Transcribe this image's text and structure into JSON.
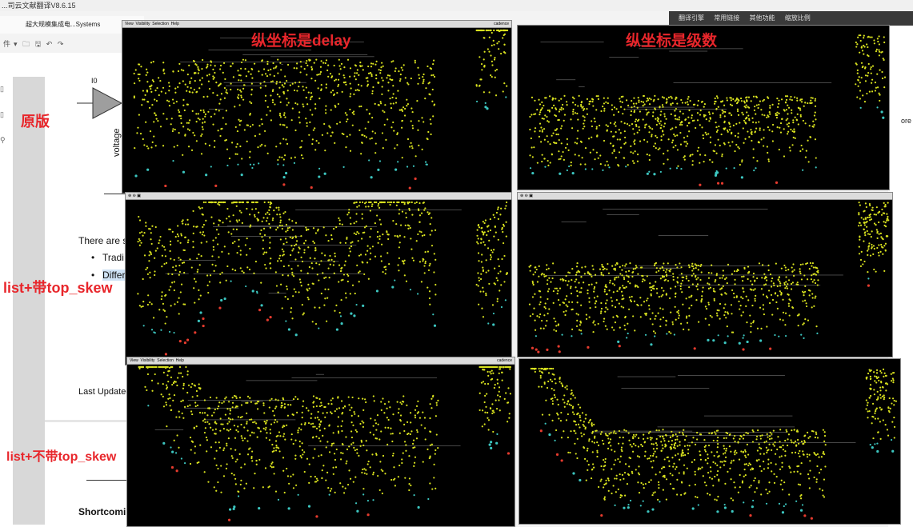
{
  "window": {
    "title": "...司云文献翻译V8.6.15"
  },
  "tab": {
    "label": "超大规模集成电...Systems"
  },
  "toolbar": {
    "file_menu": "件",
    "items": [
      "folder-icon",
      "save-icon",
      "undo-icon",
      "redo-icon"
    ]
  },
  "document": {
    "label_i0": "I0",
    "ylabel": "voltage",
    "para": "There are s",
    "bullet1": "Tradi",
    "bullet2": "Differ",
    "last_updated": "Last Updated",
    "shortcoming": "Shortcomin"
  },
  "annotations": {
    "original": "原版",
    "list_top_skew": "list+带top_skew",
    "list_no_top_skew": "list+不带top_skew",
    "ylabel_delay": "纵坐标是delay",
    "ylabel_level": "纵坐标是级数"
  },
  "right_toolbar": {
    "items": [
      "翻译引擎",
      "常用链接",
      "其他功能",
      "缩放比例"
    ]
  },
  "right_pane": {
    "snippet": "ore"
  },
  "panel_menu": [
    "View",
    "Visibility",
    "Selection",
    "Help"
  ],
  "panel_tag": "cadence",
  "colors": {
    "annotation": "#e8262b",
    "plot_bg": "#000000",
    "leaf": "#e63b2e",
    "mid": "#3cc6c0",
    "node": "#d9e21f",
    "edge": "#c9c9c9"
  }
}
